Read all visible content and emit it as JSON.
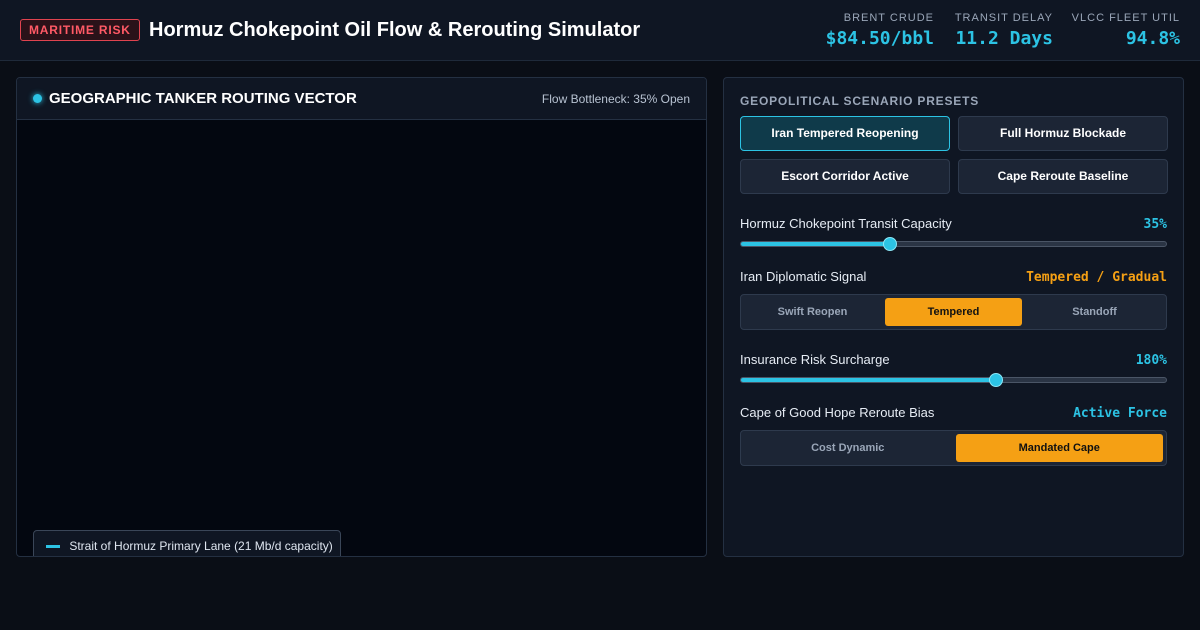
{
  "header": {
    "badge": "MARITIME RISK",
    "title": "Hormuz Chokepoint Oil Flow & Rerouting Simulator",
    "metrics": [
      {
        "label": "BRENT CRUDE",
        "value": "$84.50/bbl"
      },
      {
        "label": "TRANSIT DELAY",
        "value": "11.2 Days"
      },
      {
        "label": "VLCC FLEET UTIL",
        "value": "94.8%"
      }
    ]
  },
  "map": {
    "title": "GEOGRAPHIC TANKER ROUTING VECTOR",
    "status": "Flow Bottleneck: 35% Open",
    "legend": "Strait of Hormuz Primary Lane (21 Mb/d capacity)"
  },
  "controls": {
    "presets_title": "GEOPOLITICAL SCENARIO PRESETS",
    "presets": [
      "Iran Tempered Reopening",
      "Full Hormuz Blockade",
      "Escort Corridor Active",
      "Cape Reroute Baseline"
    ],
    "transit": {
      "label": "Hormuz Chokepoint Transit Capacity",
      "value": "35%",
      "level": 0.35
    },
    "signal": {
      "label": "Iran Diplomatic Signal",
      "value": "Tempered / Gradual",
      "options": [
        "Swift Reopen",
        "Tempered",
        "Standoff"
      ]
    },
    "insurance": {
      "label": "Insurance Risk Surcharge",
      "value": "180%",
      "level": 0.6
    },
    "cape": {
      "label": "Cape of Good Hope Reroute Bias",
      "value": "Active Force",
      "options": [
        "Cost Dynamic",
        "Mandated Cape"
      ]
    }
  },
  "colors": {
    "accent": "#2cc3e4",
    "warning": "#f5a014",
    "alert": "#ff5a66"
  }
}
